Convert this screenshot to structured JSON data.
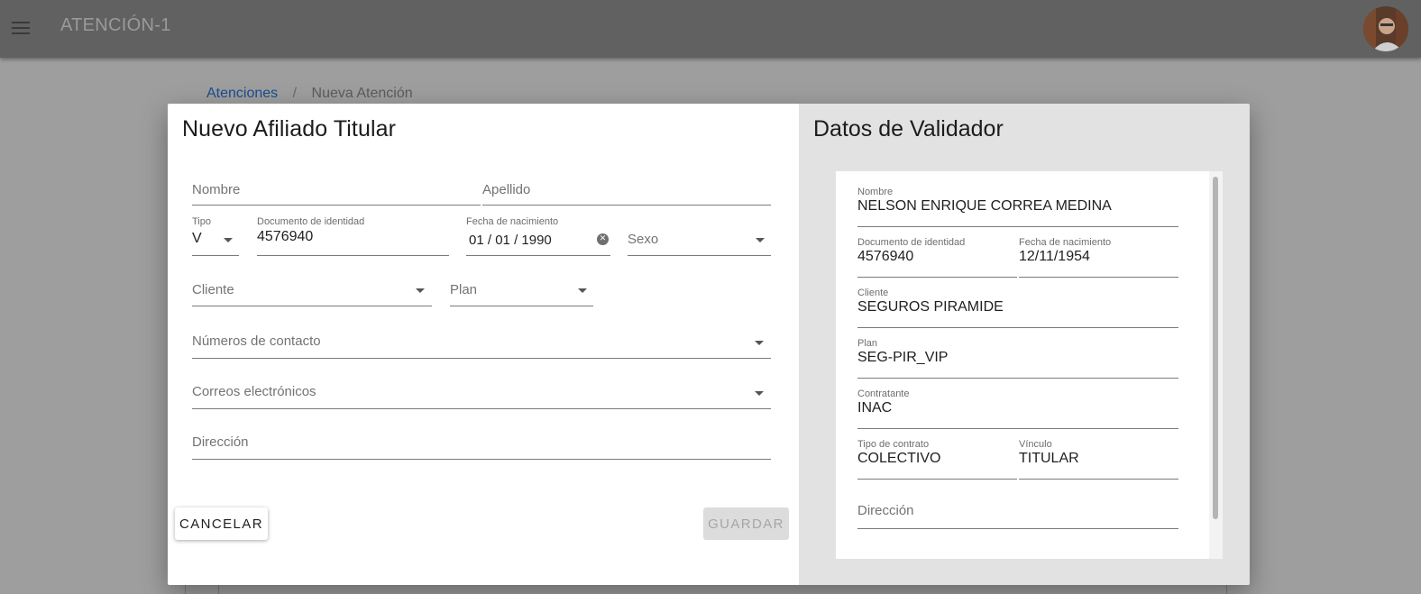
{
  "appbar": {
    "title": "ATENCIÓN-1",
    "menu_icon": "menu-icon",
    "avatar_icon": "user-avatar"
  },
  "breadcrumb": {
    "link": "Atenciones",
    "separator": "/",
    "current": "Nueva Atención"
  },
  "form": {
    "title": "Nuevo Afiliado Titular",
    "nombre": {
      "label": "Nombre",
      "value": ""
    },
    "apellido": {
      "label": "Apellido",
      "value": ""
    },
    "tipo": {
      "label": "Tipo",
      "value": "V"
    },
    "documento": {
      "label": "Documento de identidad",
      "value": "4576940"
    },
    "fecha": {
      "label": "Fecha de nacimiento",
      "day": "01",
      "month": "01",
      "year": "1990",
      "sep": "/"
    },
    "sexo": {
      "label": "Sexo",
      "value": ""
    },
    "cliente": {
      "label": "Cliente",
      "value": ""
    },
    "plan": {
      "label": "Plan",
      "value": ""
    },
    "contacto": {
      "label": "Números de contacto",
      "value": ""
    },
    "correos": {
      "label": "Correos electrónicos",
      "value": ""
    },
    "direccion": {
      "label": "Dirección",
      "value": ""
    },
    "cancel_label": "CANCELAR",
    "save_label": "GUARDAR"
  },
  "validator": {
    "title": "Datos de Validador",
    "nombre": {
      "label": "Nombre",
      "value": "NELSON ENRIQUE CORREA MEDINA"
    },
    "documento": {
      "label": "Documento de identidad",
      "value": "4576940"
    },
    "fecha": {
      "label": "Fecha de nacimiento",
      "value": "12/11/1954"
    },
    "cliente": {
      "label": "Cliente",
      "value": "SEGUROS PIRAMIDE"
    },
    "plan": {
      "label": "Plan",
      "value": "SEG-PIR_VIP"
    },
    "contratante": {
      "label": "Contratante",
      "value": "INAC"
    },
    "tipo_contrato": {
      "label": "Tipo de contrato",
      "value": "COLECTIVO"
    },
    "vinculo": {
      "label": "Vínculo",
      "value": "TITULAR"
    },
    "direccion": {
      "label": "Dirección",
      "value": ""
    }
  },
  "colors": {
    "appbar": "#616161",
    "backdrop": "#9e9e9e",
    "link": "#1a4d8f"
  }
}
